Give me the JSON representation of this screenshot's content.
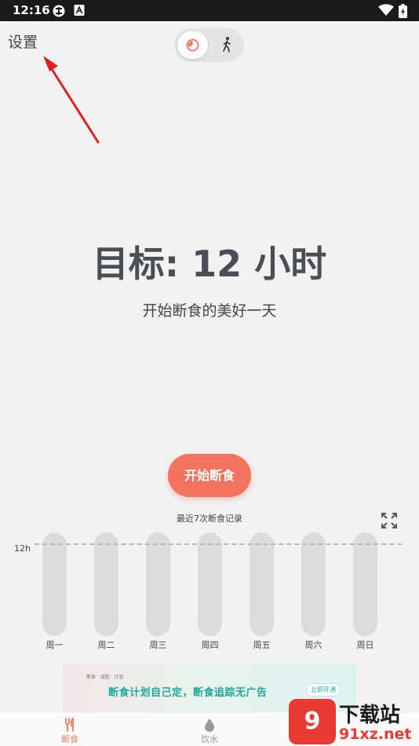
{
  "status_bar": {
    "time": "12:16"
  },
  "header": {
    "settings_label": "设置"
  },
  "goal": {
    "title": "目标: 12 小时",
    "subtitle": "开始断食的美好一天"
  },
  "actions": {
    "start_label": "开始断食"
  },
  "chart_data": {
    "type": "bar",
    "title": "最近7次断食记录",
    "categories": [
      "周一",
      "周二",
      "周三",
      "周四",
      "周五",
      "周六",
      "周日"
    ],
    "values": [
      0,
      0,
      0,
      0,
      0,
      0,
      0
    ],
    "goal_line_label": "12h",
    "goal_line_value": 12,
    "colors": {
      "bar": "#dcdcdc",
      "goal_line": "#c9b49c"
    }
  },
  "ad": {
    "tag_text": "断食 · 减肥 · 计划",
    "text": "断食计划自己定，断食追踪无广告",
    "cta": "立即开通"
  },
  "tabbar": {
    "items": [
      {
        "label": "断食",
        "icon": "utensils-icon",
        "active": true
      },
      {
        "label": "饮水",
        "icon": "water-drop-icon",
        "active": false
      }
    ]
  },
  "watermark": {
    "badge": "9",
    "title": "下载站",
    "url": "91xz.net"
  },
  "colors": {
    "accent": "#f2735e",
    "active_tab": "#f07a5e",
    "inactive_tab": "#9a9a9a",
    "annotation": "#e02020"
  }
}
